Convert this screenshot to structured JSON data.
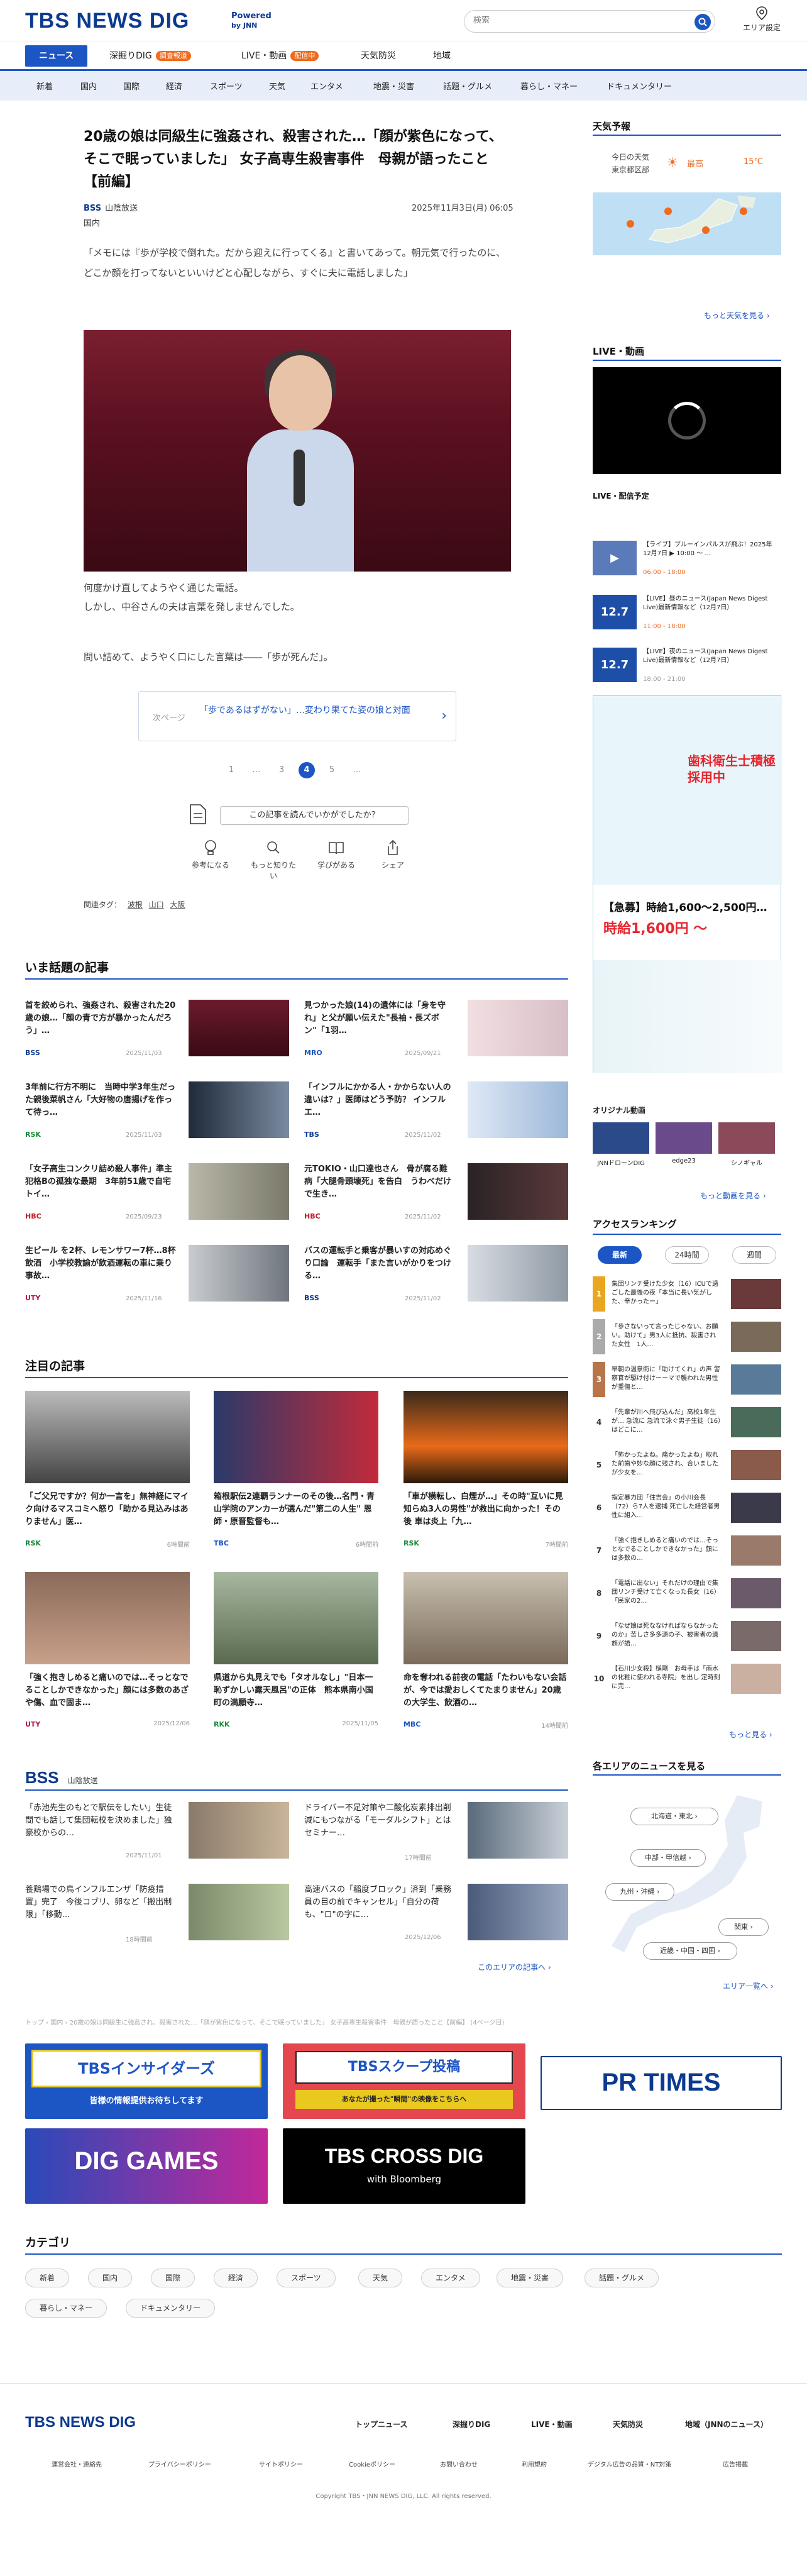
{
  "header": {
    "logo": "TBS NEWS DIG",
    "powered": "Powered",
    "powered_by": "by JNN",
    "search_placeholder": "検索",
    "area_label": "エリア設定"
  },
  "nav1": [
    {
      "label": "ニュース",
      "badge": ""
    },
    {
      "label": "深掘りDIG",
      "badge": "調査報道"
    },
    {
      "label": "LIVE・動画",
      "badge": "配信中"
    },
    {
      "label": "天気防災",
      "badge": ""
    },
    {
      "label": "地域",
      "badge": ""
    }
  ],
  "nav2": [
    "新着",
    "国内",
    "国際",
    "経済",
    "スポーツ",
    "天気",
    "エンタメ",
    "地震・災害",
    "話題・グルメ",
    "暮らし・マネー",
    "ドキュメンタリー"
  ],
  "article": {
    "title": "20歳の娘は同級生に強姦され、殺害された…「顔が紫色になって、そこで眠っていました」 女子高専生殺害事件　母親が語ったこと【前編】",
    "source": "山陰放送",
    "source_logo": "BSS",
    "category": "国内",
    "date": "2025年11月3日(月) 06:05",
    "lead": "「メモには『歩が学校で倒れた。だから迎えに行ってくる』と書いてあって。朝元気で行ったのに、どこか顔を打ってないといいけどと心配しながら、すぐに夫に電話しました」",
    "body1": "何度かけ直してようやく通じた電話。",
    "body2": "しかし、中谷さんの夫は言葉を発しませんでした。",
    "body3": "問い詰めて、ようやく口にした言葉は――「歩が死んだ」。",
    "next_label": "次ページ",
    "next_title": "「歩であるはずがない」…変わり果てた姿の娘と対面",
    "pages": [
      "1",
      "…",
      "3",
      "4",
      "5",
      "…"
    ],
    "feedback_q": "この記事を読んでいかがでしたか？",
    "feedback_btns": [
      "参考になる",
      "もっと知りたい",
      "学びがある",
      "シェア"
    ],
    "tags_label": "関連タグ：",
    "tags": [
      "波根",
      "山口",
      "大阪"
    ]
  },
  "popular": {
    "title": "いま話題の記事",
    "items": [
      {
        "t": "首を絞められ、強姦され、殺害された20歳の娘…「顔の青で方が暴かったんだろう」…",
        "m": "BSS",
        "d": "2025/11/03"
      },
      {
        "t": "見つかった娘(14)の遺体には「身を守れ」と父が願い伝えた\"長袖・長ズボン\"「1羽…",
        "m": "MRO",
        "d": "2025/09/21"
      },
      {
        "t": "3年前に行方不明に　当時中学3年生だった親後菜帆さん「大好物の唐揚げを作って待っ…",
        "m": "RSK",
        "d": "2025/11/03"
      },
      {
        "t": "「インフルにかかる人・かからない人の違いは？」医師はどう予防？ インフルエ…",
        "m": "TBS",
        "d": "2025/11/02"
      },
      {
        "t": "「女子高生コンクリ詰め殺人事件」準主犯格Bの孤独な最期　3年前51歳で自宅トイ…",
        "m": "HBC",
        "d": "2025/09/23"
      },
      {
        "t": "元TOKIO・山口達也さん　骨が腐る難病「大腿骨頭壊死」を告白　うわべだけで生き…",
        "m": "HBC",
        "d": "2025/11/02"
      },
      {
        "t": "生ビール を2杯、レモンサワー7杯…8杯飲酒　小学校教諭が飲酒運転の車に乗り事故…",
        "m": "UTY",
        "d": "2025/11/16"
      },
      {
        "t": "バスの運転手と乗客が暴いすの対応めぐり口論　運転手「また言いがかりをつける…",
        "m": "BSS",
        "d": "2025/11/02"
      }
    ]
  },
  "featured": {
    "title": "注目の記事",
    "items": [
      {
        "t": "「ご父兄ですか？何か一言を」無神経にマイク向けるマスコミへ怒り「助かる見込みはありません」医…",
        "m": "RSK",
        "d": "6時間前"
      },
      {
        "t": "箱根駅伝2連覇ランナーのその後…名門・青山学院のアンカーが選んだ\"第二の人生\" 恩師・原晋監督も…",
        "m": "TBC",
        "d": "6時間前"
      },
      {
        "t": "「車が横転し、白煙が…」その時\"互いに見知らぬ3人の男性\"が救出に向かった！その後 車は炎上「九…",
        "m": "RSK",
        "d": "7時間前"
      },
      {
        "t": "「強く抱きしめると痛いのでは…そっとなでることしかできなかった」顔には多数のあざや傷、血で固ま…",
        "m": "UTY",
        "d": "2025/12/06"
      },
      {
        "t": "県道から丸見えでも「タオルなし」\"日本一恥ずかしい露天風呂\"の正体　熊本県南小国町の満願寺…",
        "m": "RKK",
        "d": "2025/11/05"
      },
      {
        "t": "命を奪われる前夜の電話「たわいもない会話が、今では愛おしくてたまりません」20歳の大学生、飲酒の…",
        "m": "MBC",
        "d": "14時間前"
      }
    ]
  },
  "bss": {
    "logo": "BSS",
    "name": "山陰放送",
    "items": [
      {
        "t": "「赤池先生のもとで駅伝をしたい」生徒間でも話して集団転校を決めました」独豪校からの…",
        "d": "2025/11/01"
      },
      {
        "t": "ドライバー不足対策や二酸化炭素排出削減にもつながる「モーダルシフト」とは　セミナー…",
        "d": "17時間前"
      },
      {
        "t": "養鶏場での鳥インフルエンザ「防疫措置」完了　今後コブリ、卵など「搬出制限」「移動…",
        "d": "18時間前"
      },
      {
        "t": "高速バスの「稲度ブロック」済到「乗務員の目の前でキャンセル」「自分の荷も、\"ロ\"の字に…",
        "d": "2025/12/06"
      }
    ],
    "more": "このエリアの記事へ ›"
  },
  "sidebar": {
    "weather_title": "天気予報",
    "weather_label1": "今日の天気",
    "weather_label2": "東京都区部",
    "weather_cond": "最高",
    "weather_temp": "15℃",
    "weather_more": "もっと天気を見る ›",
    "live_title": "LIVE・動画",
    "live_schedule": "LIVE・配信予定",
    "live_items": [
      {
        "t": "【ライブ】ブルーインパルスが飛ぶ！2025年12月7日 ▶ 10:00 〜 …",
        "tm": "06:00 - 18:00",
        "th": "▶"
      },
      {
        "t": "【LIVE】昼のニュース(Japan News Digest Live)最新情報など（12月7日）",
        "tm": "11:00 - 18:00",
        "th": "12.7"
      },
      {
        "t": "【LIVE】夜のニュース(Japan News Digest Live)最新情報など（12月7日）",
        "tm": "18:00 - 21:00",
        "th": "12.7"
      }
    ],
    "ad_headline": "【急募】時給1,600〜2,500円…",
    "ad_price": "時給1,600円 〜",
    "ad_sub": "歯科衛生士積極採用中",
    "orig_title": "オリジナル動画",
    "orig_items": [
      "JNNドローンDIG",
      "edge23",
      "シノギャル"
    ],
    "orig_more": "もっと動画を見る ›",
    "rank_title": "アクセスランキング",
    "rank_tabs": [
      "最新",
      "24時間",
      "週間"
    ],
    "rank_items": [
      "集団リンチ受けた少女（16）ICUで過ごした最後の夜「本当に長い気がした、辛かったー」",
      "「歩さないって言ったじゃない、お願い。助けて」男3人に抵抗、殺害された女性　1人…",
      "早朝の温泉街に「助けてくれ」の声 警察官が駆け付けーーマで襲われた男性が重傷と…",
      "「先輩が川へ飛び込んだ」高校1年生が… 急流に 急流で泳ぐ男子生徒（16）はどこに…",
      "「怖かったよね。痛かったよね」取れた前歯や妙な顔に残され、合いましたが少女を…",
      "指定暴力団「住吉会」の小川会長（72）ら7人を逮捕 死亡した経営者男性に組入…",
      "「強く抱きしめると痛いのでは…そっとなでることしかできなかった」顔には多数の…",
      "「電話に出ない」それだけの理由で集団リンチ受けて亡くなった長女（16）「民家の2…",
      "「なぜ娘は死ななければならなかったのか」苦しさ多多源の子、被害者の遺族が語…",
      "【石川少女殺】槌剛　お母手は「雨水の化粧に使われる寺院」を出し 定時刻に完…"
    ],
    "rank_more": "もっと見る ›",
    "area_title": "各エリアのニュースを見る",
    "area_chips": [
      "北海道・東北 ›",
      "中部・甲信越 ›",
      "九州・沖縄 ›",
      "関東 ›",
      "近畿・中国・四国 ›"
    ],
    "area_more": "エリア一覧へ ›"
  },
  "breadcrumb": "トップ ›  国内 ›  20歳の娘は同級生に強姦され、殺害された…「顔が紫色になって、そこで眠っていました」 女子高専生殺害事件　母親が語ったこと【前編】  (4ページ目)",
  "banners": [
    "TBSインサイダーズ",
    "皆様の情報提供お待ちしてます",
    "TBSスクープ投稿",
    "あなたが撮った\"瞬間\"の映像をこちらへ",
    "PR TIMES",
    "DIG GAMES",
    "TBS CROSS DIG",
    "with Bloomberg"
  ],
  "categories": {
    "title": "カテゴリ",
    "items": [
      "新着",
      "国内",
      "国際",
      "経済",
      "スポーツ",
      "天気",
      "エンタメ",
      "地震・災害",
      "話題・グルメ",
      "暮らし・マネー",
      "ドキュメンタリー"
    ]
  },
  "footer": {
    "logo": "TBS NEWS DIG",
    "nav": [
      "トップニュース",
      "深掘りDIG",
      "LIVE・動画",
      "天気防災",
      "地域（JNNのニュース）"
    ],
    "links": [
      "運営会社・連絡先",
      "プライバシーポリシー",
      "サイトポリシー",
      "Cookieポリシー",
      "お問い合わせ",
      "利用規約",
      "デジタル広告の品質・NT対策",
      "広告掲載"
    ],
    "copyright": "Copyright TBS・JNN NEWS DIG, LLC. All rights reserved."
  },
  "colors": {
    "brand": "#1c55c4",
    "logo": "#0b3a8f",
    "accent": "#ee6b1f"
  }
}
